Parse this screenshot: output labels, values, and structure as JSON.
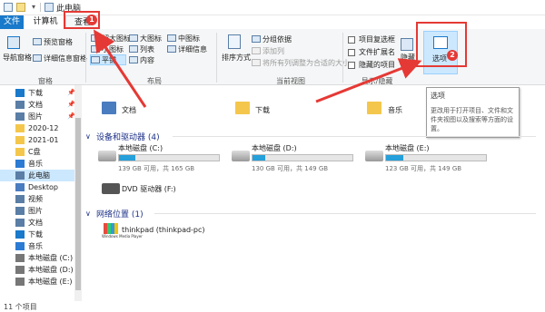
{
  "window": {
    "title": "此电脑"
  },
  "tabs": {
    "file": "文件",
    "computer": "计算机",
    "view": "查看"
  },
  "ribbon": {
    "panes": {
      "nav_pane": "导航窗格",
      "preview_pane": "预览窗格",
      "details_pane": "详细信息窗格",
      "label": "窗格"
    },
    "layout": {
      "extra_large_icons": "超大图标",
      "large_icons": "大图标",
      "medium_icons": "中图标",
      "small_icons": "小图标",
      "list": "列表",
      "details": "详细信息",
      "tiles": "平铺",
      "content": "内容",
      "label": "布局"
    },
    "current_view": {
      "sort_by": "排序方式",
      "group_by": "分组依据",
      "add_columns": "添加列",
      "size_all_columns": "将所有列调整为合适的大小",
      "label": "当前视图"
    },
    "show_hide": {
      "item_checkboxes": "项目复选框",
      "file_extensions": "文件扩展名",
      "hidden_items": "隐藏的项目",
      "hide_selected": "隐藏",
      "label": "显示/隐藏"
    },
    "options": {
      "label": "选项"
    }
  },
  "tooltip": {
    "title": "选项",
    "body": "更改用于打开项目、文件和文件夹视图以及搜索等方面的设置。"
  },
  "nav": {
    "items": [
      {
        "label": "下载",
        "pinned": true
      },
      {
        "label": "文档",
        "pinned": true
      },
      {
        "label": "图片",
        "pinned": true
      },
      {
        "label": "2020-12",
        "pinned": false
      },
      {
        "label": "2021-01",
        "pinned": false
      },
      {
        "label": "C盘",
        "pinned": false
      },
      {
        "label": "音乐",
        "pinned": false
      },
      {
        "label": "此电脑",
        "pinned": false
      },
      {
        "label": "Desktop",
        "pinned": false
      },
      {
        "label": "视频",
        "pinned": false
      },
      {
        "label": "图片",
        "pinned": false
      },
      {
        "label": "文档",
        "pinned": false
      },
      {
        "label": "下载",
        "pinned": false
      },
      {
        "label": "音乐",
        "pinned": false
      },
      {
        "label": "本地磁盘 (C:)",
        "pinned": false
      },
      {
        "label": "本地磁盘 (D:)",
        "pinned": false
      },
      {
        "label": "本地磁盘 (E:)",
        "pinned": false
      }
    ]
  },
  "folders": [
    {
      "label": "文档"
    },
    {
      "label": "下载"
    },
    {
      "label": "音乐"
    }
  ],
  "devices": {
    "header": "设备和驱动器 (4)",
    "drives": [
      {
        "name": "本地磁盘 (C:)",
        "free": "139 GB 可用，共 165 GB",
        "used_fraction": 0.16
      },
      {
        "name": "本地磁盘 (D:)",
        "free": "130 GB 可用，共 149 GB",
        "used_fraction": 0.13
      },
      {
        "name": "本地磁盘 (E:)",
        "free": "123 GB 可用，共 149 GB",
        "used_fraction": 0.17
      }
    ],
    "dvd": {
      "name": "DVD 驱动器 (F:)"
    }
  },
  "network": {
    "header": "网络位置 (1)",
    "items": [
      {
        "label": "thinkpad (thinkpad-pc)",
        "icon_text": "Windows Media Player"
      }
    ]
  },
  "status": {
    "count": "11 个项目"
  },
  "annotations": {
    "badge1": "1",
    "badge2": "2"
  },
  "colors": {
    "accent": "#1979ca",
    "annotation": "#e53935",
    "drive_bar": "#26a0da"
  }
}
